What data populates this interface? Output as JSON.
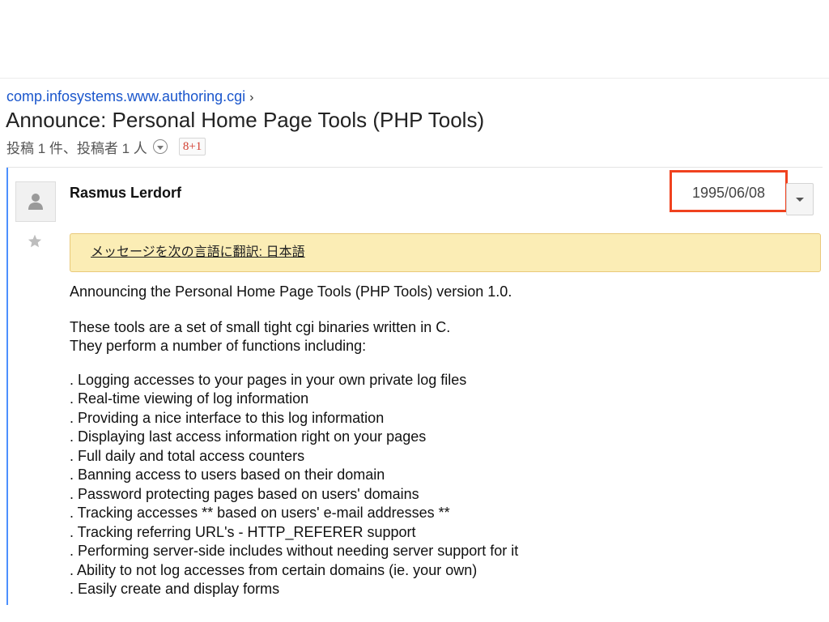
{
  "thread": {
    "group_name": "comp.infosystems.www.authoring.cgi",
    "breadcrumb_separator": "›",
    "title": "Announce: Personal Home Page Tools (PHP Tools)",
    "meta_text": "投稿 1 件、投稿者 1 人",
    "gplus_label": "8+1"
  },
  "message": {
    "author": "Rasmus Lerdorf",
    "date": "1995/06/08",
    "translate_link": "メッセージを次の言語に翻訳: 日本語",
    "body": {
      "intro": "Announcing the Personal Home Page Tools (PHP Tools) version 1.0.",
      "desc_line1": "These tools are a set of small tight cgi binaries written in C.",
      "desc_line2": "They perform a number of functions including:",
      "features": [
        ". Logging accesses to your pages in your own private log files",
        ". Real-time viewing of log information",
        ". Providing a nice interface to this log information",
        ". Displaying last access information right on your pages",
        ". Full daily and total access counters",
        ". Banning access to users based on their domain",
        ". Password protecting pages based on users' domains",
        ". Tracking accesses ** based on users' e-mail addresses **",
        ". Tracking referring URL's - HTTP_REFERER support",
        ". Performing server-side includes without needing server support for it",
        ". Ability to not log accesses from certain domains (ie. your own)",
        ". Easily create and display forms"
      ]
    }
  },
  "icons": {
    "avatar": "person-icon",
    "star": "star-icon",
    "more": "chevron-down-icon",
    "meta_dropdown": "circle-chevron-down-icon"
  },
  "colors": {
    "link": "#1a56cc",
    "thread_bar": "#4d90fe",
    "highlight_box": "#f0421f",
    "translate_banner": "#fbedb5",
    "gplus": "#d23f31"
  }
}
